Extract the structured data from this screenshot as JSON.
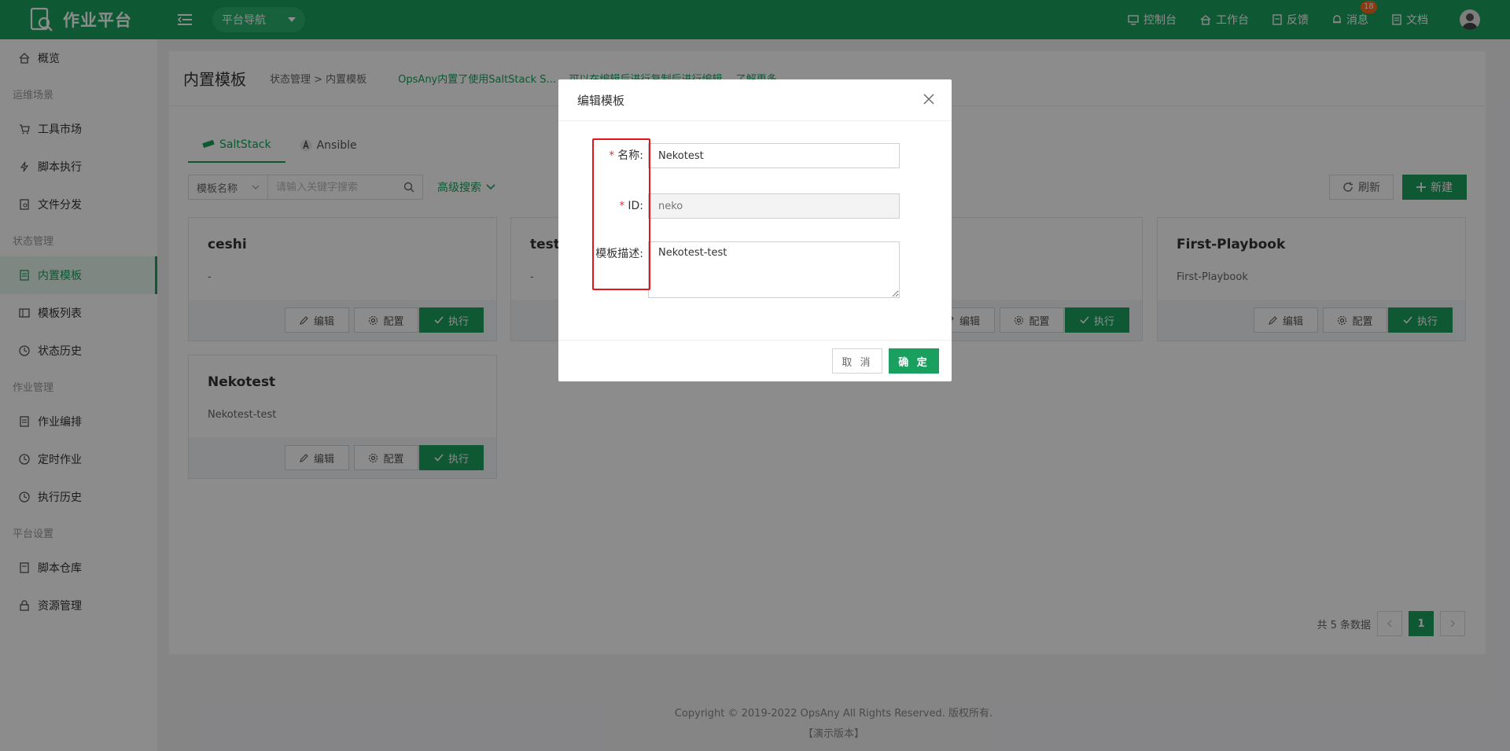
{
  "topbar": {
    "app_title": "作业平台",
    "platform_nav": "平台导航",
    "links": [
      "控制台",
      "工作台",
      "反馈",
      "消息",
      "文档"
    ],
    "message_badge": "18"
  },
  "sidebar": {
    "overview": "概览",
    "groups": [
      {
        "title": "运维场景",
        "items": [
          "工具市场",
          "脚本执行",
          "文件分发"
        ]
      },
      {
        "title": "状态管理",
        "items": [
          "内置模板",
          "模板列表",
          "状态历史"
        ]
      },
      {
        "title": "作业管理",
        "items": [
          "作业编排",
          "定时作业",
          "执行历史"
        ]
      },
      {
        "title": "平台设置",
        "items": [
          "脚本仓库",
          "资源管理"
        ]
      }
    ]
  },
  "page": {
    "title": "内置模板",
    "breadcrumb": "状态管理 > 内置模板",
    "note": "OpsAny内置了使用SaltStack S...  ...可以在编辑后进行复制后进行编辑。 了解更多",
    "tabs": [
      "SaltStack",
      "Ansible"
    ],
    "search": {
      "select_label": "模板名称",
      "placeholder": "请输入关键字搜索",
      "advanced": "高级搜索"
    },
    "refresh_label": "刷新",
    "new_label": "新建",
    "cards": [
      {
        "title": "ceshi",
        "desc": "-"
      },
      {
        "title": "test",
        "desc": "-"
      },
      {
        "title": "",
        "desc": ""
      },
      {
        "title": "First-Playbook",
        "desc": "First-Playbook"
      },
      {
        "title": "Nekotest",
        "desc": "Nekotest-test"
      }
    ],
    "card_buttons": {
      "edit": "编辑",
      "config": "配置",
      "run": "执行"
    },
    "pager": {
      "total": "共 5 条数据",
      "current": "1"
    }
  },
  "footer": {
    "copyright": "Copyright © 2019-2022 OpsAny All Rights Reserved. 版权所有.",
    "version": "【演示版本】"
  },
  "modal": {
    "title": "编辑模板",
    "name_label": "名称:",
    "name_value": "Nekotest",
    "id_label": "ID:",
    "id_value": "neko",
    "desc_label": "模板描述:",
    "desc_value": "Nekotest-test",
    "cancel_label": "取 消",
    "ok_label": "确 定"
  },
  "colors": {
    "brand": "#1aa05e",
    "highlight_frame": "#e8141c"
  }
}
